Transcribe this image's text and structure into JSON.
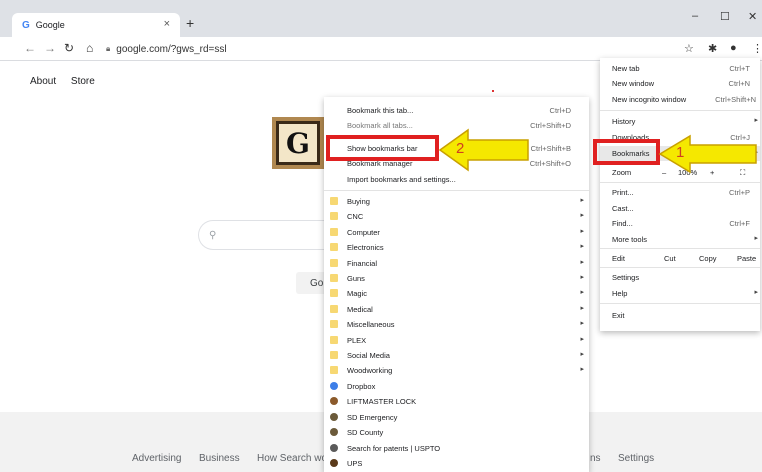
{
  "browser": {
    "tab_title": "Google",
    "tab_favicon": "G",
    "tab_close": "×",
    "new_tab": "+",
    "url": "google.com/?gws_rd=ssl",
    "window_controls": {
      "minimize": "–",
      "maximize": "☐",
      "close": "✕"
    }
  },
  "page": {
    "top_links": [
      "About",
      "Store"
    ],
    "doodle_letter": "G",
    "search_button_partial": "Go",
    "footer_links": [
      "Advertising",
      "Business",
      "How Search wo",
      "ns",
      "Settings"
    ]
  },
  "main_menu": {
    "items": [
      {
        "label": "New tab",
        "shortcut": "Ctrl+T"
      },
      {
        "label": "New window",
        "shortcut": "Ctrl+N"
      },
      {
        "label": "New incognito window",
        "shortcut": "Ctrl+Shift+N"
      },
      {
        "label": "History",
        "shortcut": ""
      },
      {
        "label": "Downloads",
        "shortcut": "Ctrl+J"
      },
      {
        "label": "Bookmarks",
        "shortcut": ""
      },
      {
        "label": "Zoom",
        "shortcut": ""
      },
      {
        "label": "Print...",
        "shortcut": "Ctrl+P"
      },
      {
        "label": "Cast...",
        "shortcut": ""
      },
      {
        "label": "Find...",
        "shortcut": "Ctrl+F"
      },
      {
        "label": "More tools",
        "shortcut": ""
      },
      {
        "label": "Edit",
        "shortcut": ""
      },
      {
        "label": "Settings",
        "shortcut": ""
      },
      {
        "label": "Help",
        "shortcut": ""
      },
      {
        "label": "Exit",
        "shortcut": ""
      }
    ],
    "zoom": {
      "minus": "–",
      "value": "100%",
      "plus": "+",
      "fullscreen": "⛶"
    },
    "edit": {
      "cut": "Cut",
      "copy": "Copy",
      "paste": "Paste"
    }
  },
  "bookmarks_menu": {
    "top_items": [
      {
        "label": "Bookmark this tab...",
        "shortcut": "Ctrl+D"
      },
      {
        "label": "Bookmark all tabs...",
        "shortcut": "Ctrl+Shift+D"
      },
      {
        "label": "Show bookmarks bar",
        "shortcut": "Ctrl+Shift+B"
      },
      {
        "label": "Bookmark manager",
        "shortcut": "Ctrl+Shift+O"
      },
      {
        "label": "Import bookmarks and settings...",
        "shortcut": ""
      }
    ],
    "folders": [
      "Buying",
      "CNC",
      "Computer",
      "Electronics",
      "Financial",
      "Guns",
      "Magic",
      "Medical",
      "Miscellaneous",
      "PLEX",
      "Social Media",
      "Woodworking"
    ],
    "links": [
      {
        "label": "Dropbox",
        "icon": "dropbox-icon"
      },
      {
        "label": "LIFTMASTER LOCK",
        "icon": "liftmaster-icon"
      },
      {
        "label": "SD Emergency",
        "icon": "globe-icon"
      },
      {
        "label": "SD County",
        "icon": "globe-icon"
      },
      {
        "label": "Search for patents | USPTO",
        "icon": "patent-icon"
      },
      {
        "label": "UPS",
        "icon": "ups-icon"
      }
    ]
  },
  "annotations": {
    "step1": "1",
    "step2": "2",
    "color": "#e02020",
    "arrow_fill": "#f5e800"
  }
}
